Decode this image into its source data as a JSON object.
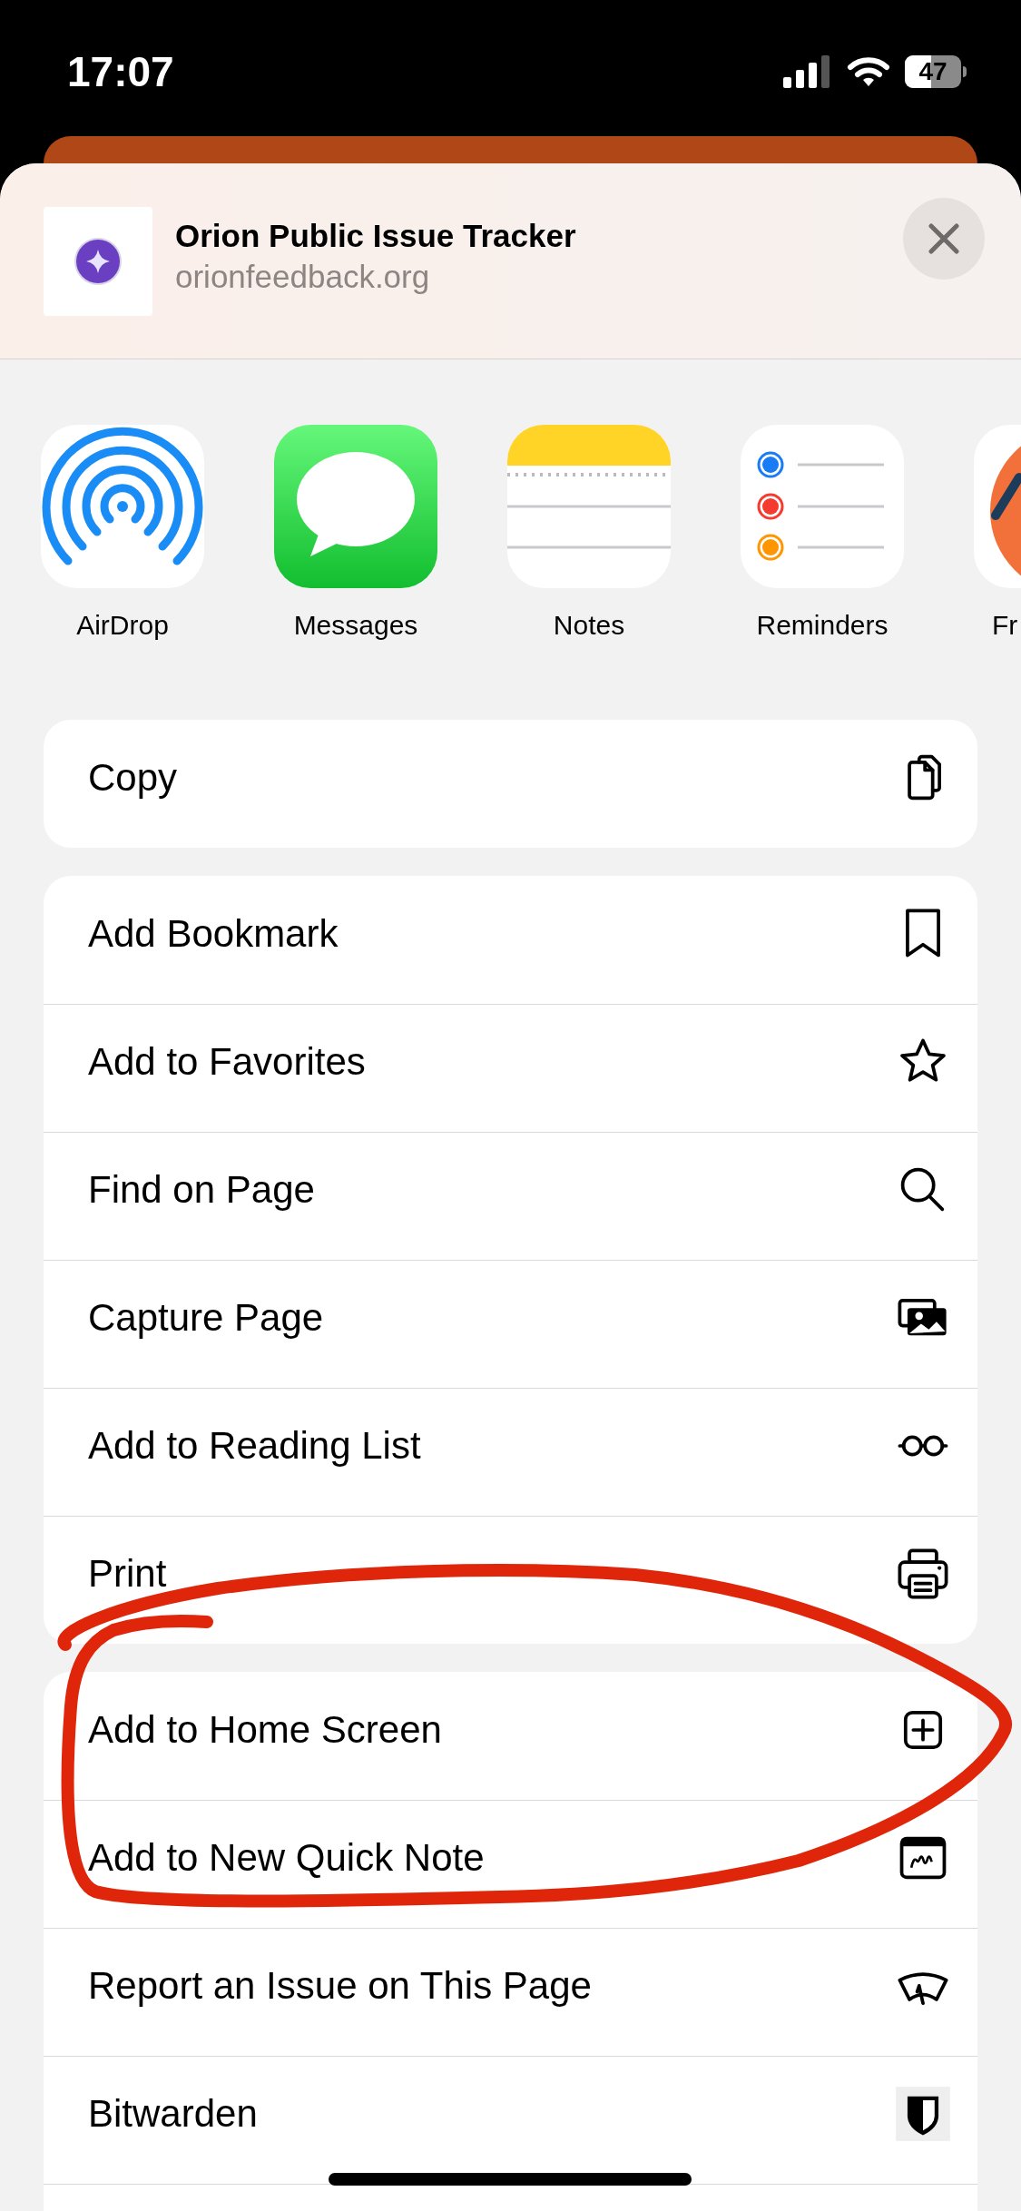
{
  "status_bar": {
    "time": "17:07",
    "battery": "47"
  },
  "header": {
    "title": "Orion Public Issue Tracker",
    "url": "orionfeedback.org"
  },
  "apps": [
    {
      "label": "AirDrop"
    },
    {
      "label": "Messages"
    },
    {
      "label": "Notes"
    },
    {
      "label": "Reminders"
    },
    {
      "label": "Fr"
    }
  ],
  "action_groups": [
    [
      {
        "label": "Copy"
      }
    ],
    [
      {
        "label": "Add Bookmark"
      },
      {
        "label": "Add to Favorites"
      },
      {
        "label": "Find on Page"
      },
      {
        "label": "Capture Page"
      },
      {
        "label": "Add to Reading List"
      },
      {
        "label": "Print"
      }
    ],
    [
      {
        "label": "Add to Home Screen"
      },
      {
        "label": "Add to New Quick Note"
      },
      {
        "label": "Report an Issue on This Page"
      },
      {
        "label": "Bitwarden"
      }
    ]
  ]
}
